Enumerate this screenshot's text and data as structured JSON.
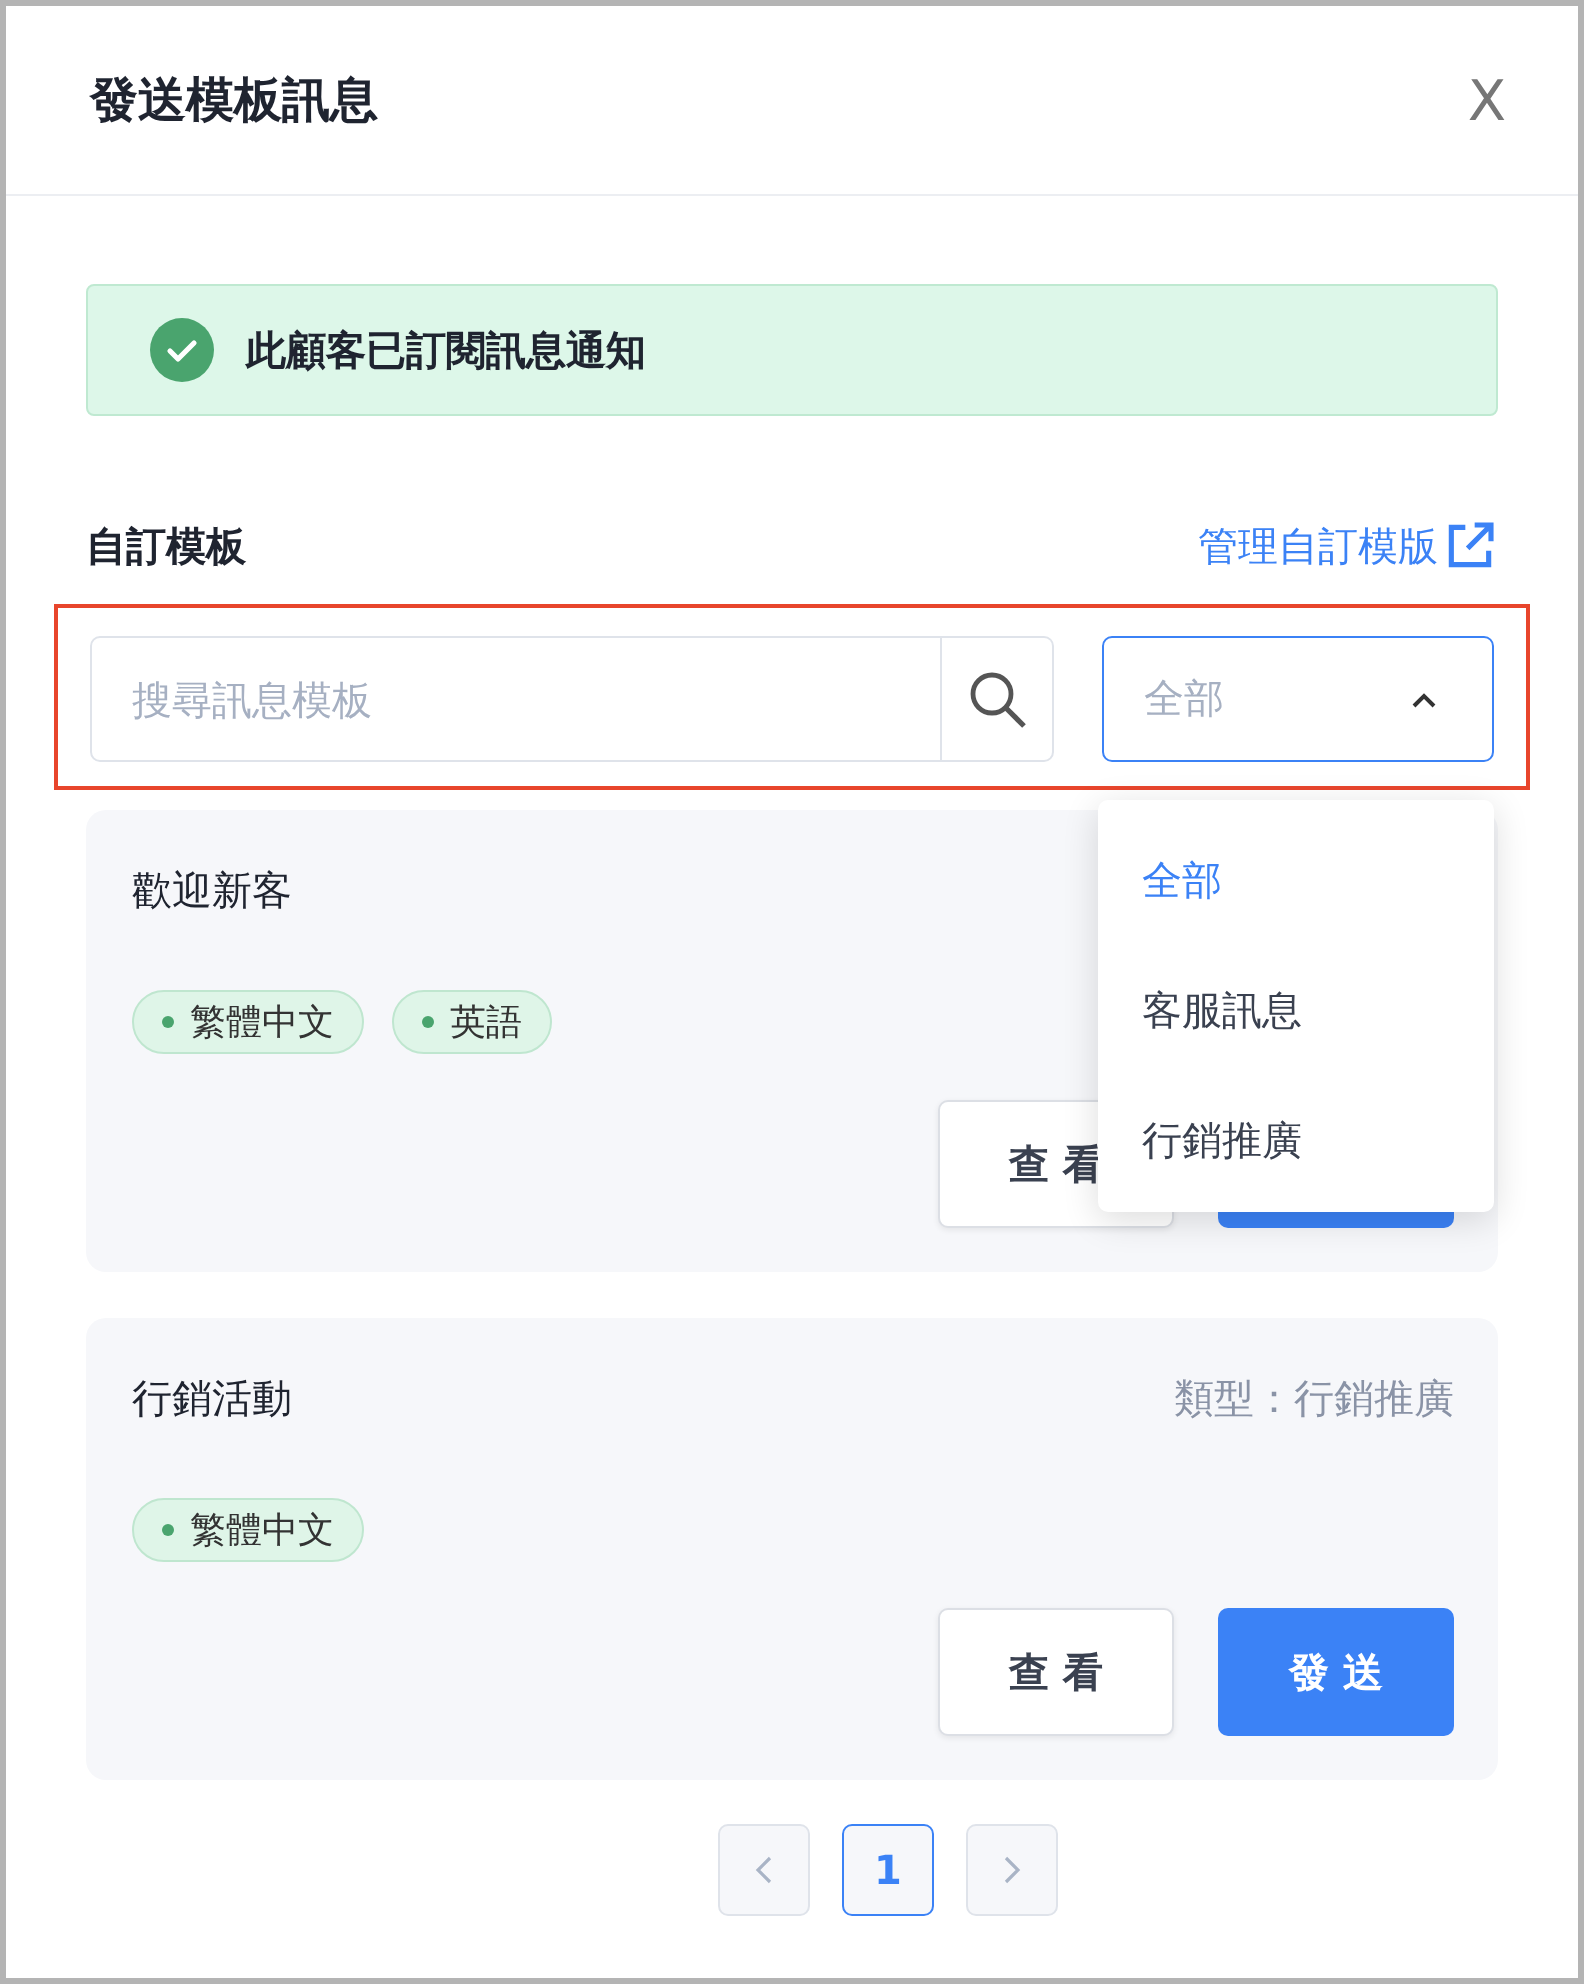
{
  "dialog": {
    "title": "發送模板訊息",
    "close": "X"
  },
  "alert": {
    "text": "此顧客已訂閱訊息通知"
  },
  "section": {
    "title": "自訂模板",
    "link": "管理自訂模版"
  },
  "filter": {
    "highlighted": true,
    "search": {
      "placeholder": "搜尋訊息模板"
    },
    "select": {
      "value": "全部",
      "expanded": true
    },
    "options": [
      {
        "label": "全部",
        "selected": true
      },
      {
        "label": "客服訊息",
        "selected": false
      },
      {
        "label": "行銷推廣",
        "selected": false
      }
    ]
  },
  "templates": [
    {
      "name": "歡迎新客",
      "tags": [
        "繁體中文",
        "英語"
      ],
      "buttons": [
        {
          "kind": "view",
          "label": "查 看"
        },
        {
          "kind": "send"
        }
      ]
    },
    {
      "name": "行銷活動",
      "type": "類型：行銷推廣",
      "tags": [
        "繁體中文"
      ],
      "buttons": [
        {
          "kind": "view",
          "label": "查 看"
        },
        {
          "kind": "send",
          "label": "發 送"
        }
      ]
    }
  ],
  "pagination": {
    "pages": [
      {
        "label": "1",
        "selected": true
      }
    ]
  }
}
